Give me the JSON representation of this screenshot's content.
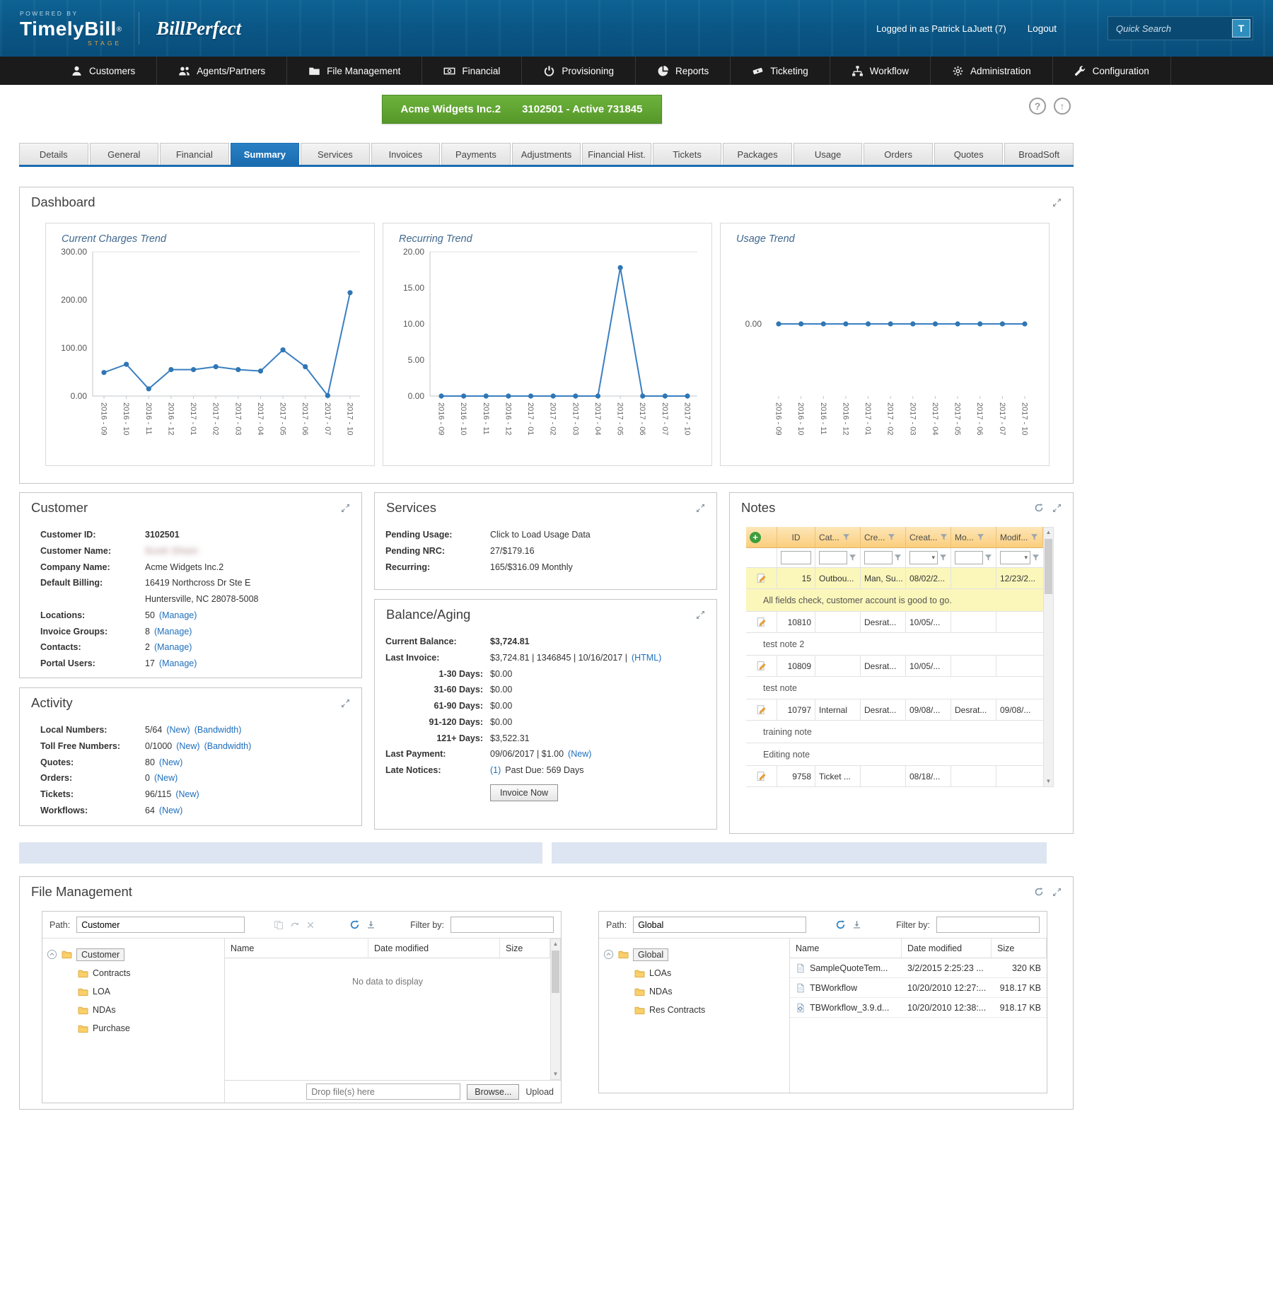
{
  "header": {
    "powered_by": "POWERED BY",
    "logo_text": "TimelyBill",
    "logo_mark": "®",
    "logo_stage": "STAGE",
    "brand_secondary": "BillPerfect",
    "logged_in_text": "Logged in as Patrick LaJuett (7)",
    "logout_label": "Logout",
    "search_placeholder": "Quick Search",
    "search_button_label": "T"
  },
  "nav": {
    "items": [
      {
        "label": "Customers",
        "icon": "user"
      },
      {
        "label": "Agents/Partners",
        "icon": "users"
      },
      {
        "label": "File Management",
        "icon": "folder"
      },
      {
        "label": "Financial",
        "icon": "money"
      },
      {
        "label": "Provisioning",
        "icon": "power"
      },
      {
        "label": "Reports",
        "icon": "pie"
      },
      {
        "label": "Ticketing",
        "icon": "ticket"
      },
      {
        "label": "Workflow",
        "icon": "sitemap"
      },
      {
        "label": "Administration",
        "icon": "gear"
      },
      {
        "label": "Configuration",
        "icon": "wrench"
      }
    ]
  },
  "account_banner": {
    "company": "Acme Widgets Inc.2",
    "account": "3102501 - Active 731845"
  },
  "tabs": {
    "active": "Summary",
    "items": [
      "Details",
      "General",
      "Financial",
      "Summary",
      "Services",
      "Invoices",
      "Payments",
      "Adjustments",
      "Financial Hist.",
      "Tickets",
      "Packages",
      "Usage",
      "Orders",
      "Quotes",
      "BroadSoft"
    ]
  },
  "dashboard": {
    "title": "Dashboard"
  },
  "chart_data": [
    {
      "type": "line",
      "title": "Current Charges Trend",
      "x": [
        "2016 - 09",
        "2016 - 10",
        "2016 - 11",
        "2016 - 12",
        "2017 - 01",
        "2017 - 02",
        "2017 - 03",
        "2017 - 04",
        "2017 - 05",
        "2017 - 06",
        "2017 - 07",
        "2017 - 10"
      ],
      "values": [
        49,
        66,
        15,
        55,
        55,
        61,
        55,
        52,
        96,
        61,
        1,
        215
      ],
      "ylim": [
        0,
        300
      ],
      "yticks": [
        0,
        100,
        200,
        300
      ],
      "ytick_labels": [
        "0.00",
        "100.00",
        "200.00",
        "300.00"
      ],
      "line_color": "#3a7fc1",
      "legend": "none",
      "grid": "top-only"
    },
    {
      "type": "line",
      "title": "Recurring Trend",
      "x": [
        "2016 - 09",
        "2016 - 10",
        "2016 - 11",
        "2016 - 12",
        "2017 - 01",
        "2017 - 02",
        "2017 - 03",
        "2017 - 04",
        "2017 - 05",
        "2017 - 06",
        "2017 - 07",
        "2017 - 10"
      ],
      "values": [
        0,
        0,
        0,
        0,
        0,
        0,
        0,
        0,
        17.8,
        0,
        0,
        0
      ],
      "ylim": [
        0,
        20
      ],
      "yticks": [
        0,
        5,
        10,
        15,
        20
      ],
      "ytick_labels": [
        "0.00",
        "5.00",
        "10.00",
        "15.00",
        "20.00"
      ],
      "line_color": "#3a7fc1",
      "legend": "none",
      "grid": "top-only"
    },
    {
      "type": "line",
      "title": "Usage Trend",
      "x": [
        "2016 - 09",
        "2016 - 10",
        "2016 - 11",
        "2016 - 12",
        "2017 - 01",
        "2017 - 02",
        "2017 - 03",
        "2017 - 04",
        "2017 - 05",
        "2017 - 06",
        "2017 - 07",
        "2017 - 10"
      ],
      "values": [
        0,
        0,
        0,
        0,
        0,
        0,
        0,
        0,
        0,
        0,
        0,
        0
      ],
      "ylim": [
        0,
        0
      ],
      "yticks": [
        0
      ],
      "ytick_labels": [
        "0.00"
      ],
      "show_axes": false,
      "line_color": "#3a7fc1",
      "legend": "none",
      "grid": "off"
    }
  ],
  "customer": {
    "title": "Customer",
    "rows": [
      {
        "label": "Customer ID:",
        "value": "3102501",
        "bold": true
      },
      {
        "label": "Customer Name:",
        "value": "Scott Olsen",
        "blurred": true
      },
      {
        "label": "Company Name:",
        "value": "Acme Widgets Inc.2"
      },
      {
        "label": "Default Billing:",
        "value": "16419 Northcross Dr Ste E",
        "value2": "Huntersville, NC 28078-5008"
      },
      {
        "label": "Locations:",
        "value": "50",
        "links": [
          "(Manage)"
        ]
      },
      {
        "label": "Invoice Groups:",
        "value": "8",
        "links": [
          "(Manage)"
        ]
      },
      {
        "label": "Contacts:",
        "value": "2",
        "links": [
          "(Manage)"
        ]
      },
      {
        "label": "Portal Users:",
        "value": "17",
        "links": [
          "(Manage)"
        ]
      }
    ]
  },
  "activity": {
    "title": "Activity",
    "rows": [
      {
        "label": "Local Numbers:",
        "value": "5/64",
        "links": [
          "(New)",
          "(Bandwidth)"
        ]
      },
      {
        "label": "Toll Free Numbers:",
        "value": "0/1000",
        "links": [
          "(New)",
          "(Bandwidth)"
        ]
      },
      {
        "label": "Quotes:",
        "value": "80",
        "links": [
          "(New)"
        ]
      },
      {
        "label": "Orders:",
        "value": "0",
        "links": [
          "(New)"
        ]
      },
      {
        "label": "Tickets:",
        "value": "96/115",
        "links": [
          "(New)"
        ]
      },
      {
        "label": "Workflows:",
        "value": "64",
        "links": [
          "(New)"
        ]
      }
    ]
  },
  "services": {
    "title": "Services",
    "rows": [
      {
        "label": "Pending Usage:",
        "value": "Click to Load Usage Data",
        "action": true
      },
      {
        "label": "Pending NRC:",
        "value": "27/$179.16"
      },
      {
        "label": "Recurring:",
        "value": "165/$316.09 Monthly"
      }
    ]
  },
  "balance_aging": {
    "title": "Balance/Aging",
    "rows": [
      {
        "label": "Current Balance:",
        "value": "$3,724.81",
        "bold": true
      },
      {
        "label": "Last Invoice:",
        "value": "$3,724.81 | 1346845 | 10/16/2017 |",
        "link": "(HTML)"
      },
      {
        "label": "1-30 Days:",
        "value": "$0.00",
        "indent": true
      },
      {
        "label": "31-60 Days:",
        "value": "$0.00",
        "indent": true
      },
      {
        "label": "61-90 Days:",
        "value": "$0.00",
        "indent": true
      },
      {
        "label": "91-120 Days:",
        "value": "$0.00",
        "indent": true
      },
      {
        "label": "121+ Days:",
        "value": "$3,522.31",
        "indent": true
      },
      {
        "label": "Last Payment:",
        "value": "09/06/2017 | $1.00",
        "link": "(New)"
      },
      {
        "label": "Late Notices:",
        "link_first": "(1)",
        "value": "Past Due: 569 Days"
      }
    ],
    "invoice_now_label": "Invoice Now"
  },
  "notes": {
    "title": "Notes",
    "columns": [
      "ID",
      "Cat...",
      "Cre...",
      "Creat...",
      "Mo...",
      "Modif..."
    ],
    "rows": [
      {
        "id": "15",
        "cat": "Outbou...",
        "cre": "Man, Su...",
        "creat": "08/02/2...",
        "modif": "12/23/2...",
        "note": "All fields check, customer account is good to go.",
        "highlight": true
      },
      {
        "id": "10810",
        "cre": "Desrat...",
        "creat": "10/05/...",
        "note": "test note 2"
      },
      {
        "id": "10809",
        "cre": "Desrat...",
        "creat": "10/05/...",
        "note": "test note"
      },
      {
        "id": "10797",
        "cat": "Internal",
        "cre": "Desrat...",
        "creat": "09/08/...",
        "mo": "Desrat...",
        "modif": "09/08/...",
        "note": "training note"
      },
      {
        "note_only": true,
        "note": "Editing note"
      },
      {
        "id": "9758",
        "cat": "Ticket ...",
        "creat": "08/18/..."
      }
    ]
  },
  "file_management": {
    "title": "File Management",
    "panes": [
      {
        "path_label": "Path:",
        "path_value": "Customer",
        "filter_label": "Filter by:",
        "tree_root": "Customer",
        "tree_children": [
          "Contracts",
          "LOA",
          "NDAs",
          "Purchase"
        ],
        "columns": [
          "Name",
          "Date modified",
          "Size"
        ],
        "empty_text": "No data to display",
        "rows": [],
        "drop_placeholder": "Drop file(s) here",
        "browse_label": "Browse...",
        "upload_label": "Upload"
      },
      {
        "path_label": "Path:",
        "path_value": "Global",
        "filter_label": "Filter by:",
        "tree_root": "Global",
        "tree_children": [
          "LOAs",
          "NDAs",
          "Res Contracts"
        ],
        "columns": [
          "Name",
          "Date modified",
          "Size"
        ],
        "rows": [
          {
            "name": "SampleQuoteTem...",
            "date": "3/2/2015 2:25:23 ...",
            "size": "320 KB",
            "icon": "file"
          },
          {
            "name": "TBWorkflow",
            "date": "10/20/2010 12:27:...",
            "size": "918.17 KB",
            "icon": "file"
          },
          {
            "name": "TBWorkflow_3.9.d...",
            "date": "10/20/2010 12:38:...",
            "size": "918.17 KB",
            "icon": "file-gear"
          }
        ]
      }
    ]
  },
  "theme": {
    "header_blue": "#0a5584",
    "nav_black": "#1b1b1b",
    "banner_green": "#5da02f",
    "active_tab_blue": "#1a6cb0",
    "link_blue": "#1e6fbd",
    "grid_header_orange": "#fbce7c",
    "note_highlight_yellow": "#fbf7bb"
  }
}
